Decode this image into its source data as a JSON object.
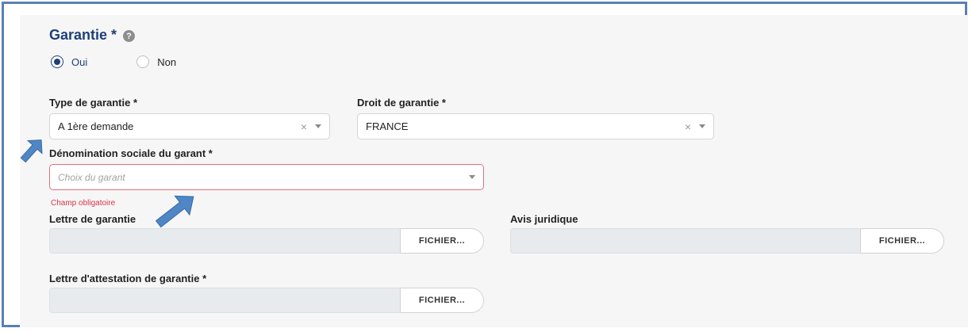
{
  "section": {
    "title": "Garantie *",
    "help_glyph": "?"
  },
  "radio": {
    "options": [
      {
        "label": "Oui",
        "checked": true
      },
      {
        "label": "Non",
        "checked": false
      }
    ]
  },
  "fields": {
    "type_garantie": {
      "label": "Type de garantie *",
      "value": "A 1ère demande"
    },
    "droit_garantie": {
      "label": "Droit de garantie *",
      "value": "FRANCE"
    },
    "denomination": {
      "label": "Dénomination sociale du garant *",
      "placeholder": "Choix du garant",
      "error": "Champ obligatoire"
    },
    "lettre_garantie": {
      "label": "Lettre de garantie",
      "button": "FICHIER..."
    },
    "avis_juridique": {
      "label": "Avis juridique",
      "button": "FICHIER..."
    },
    "lettre_attestation": {
      "label": "Lettre d'attestation de garantie *",
      "button": "FICHIER..."
    }
  },
  "select_clear_glyph": "×",
  "icons": {
    "help": "help-circle-icon",
    "clear": "close-icon",
    "caret": "chevron-down-icon",
    "annotation": "arrow-annotation-icon"
  },
  "colors": {
    "title": "#1f3f78",
    "frame": "#5a7fb5",
    "error": "#d9344a",
    "arrow": "#4f86c6"
  }
}
